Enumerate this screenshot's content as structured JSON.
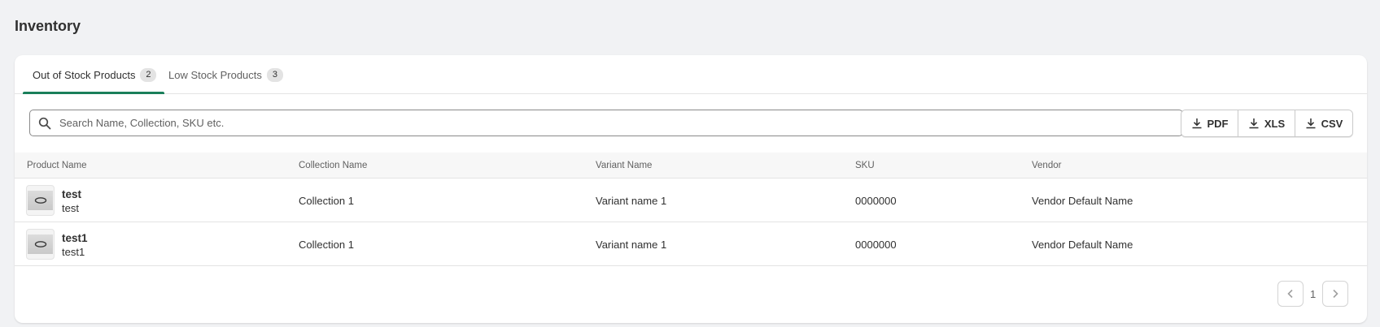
{
  "page": {
    "title": "Inventory"
  },
  "tabs": [
    {
      "label": "Out of Stock Products",
      "count": "2",
      "active": true
    },
    {
      "label": "Low Stock Products",
      "count": "3",
      "active": false
    }
  ],
  "search": {
    "placeholder": "Search Name, Collection, SKU etc.",
    "value": ""
  },
  "export": {
    "pdf": "PDF",
    "xls": "XLS",
    "csv": "CSV"
  },
  "table": {
    "columns": [
      "Product Name",
      "Collection Name",
      "Variant Name",
      "SKU",
      "Vendor"
    ],
    "rows": [
      {
        "title": "test",
        "subtitle": "test",
        "collection": "Collection 1",
        "variant": "Variant name 1",
        "sku": "0000000",
        "vendor": "Vendor Default Name"
      },
      {
        "title": "test1",
        "subtitle": "test1",
        "collection": "Collection 1",
        "variant": "Variant name 1",
        "sku": "0000000",
        "vendor": "Vendor Default Name"
      }
    ]
  },
  "pagination": {
    "current_page": "1"
  },
  "colors": {
    "accent": "#1a7f5a",
    "background": "#f1f2f4"
  }
}
